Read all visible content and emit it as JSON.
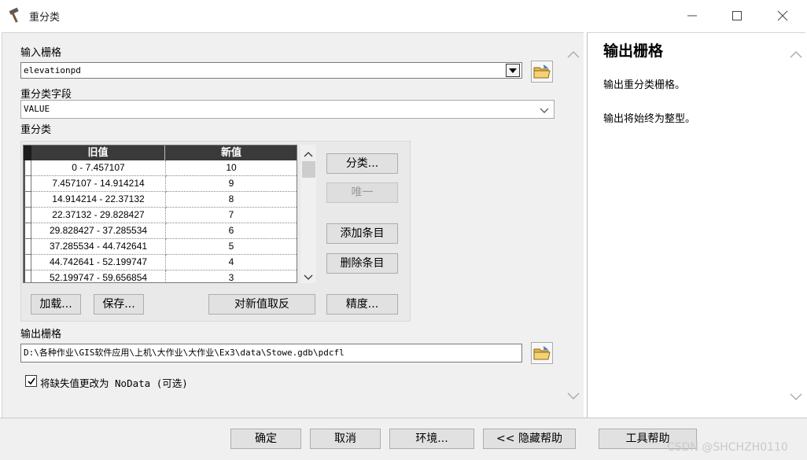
{
  "window": {
    "title": "重分类",
    "icons": {
      "app": "hammer-icon",
      "minimize": "minimize-icon",
      "maximize": "maximize-icon",
      "close": "close-icon"
    }
  },
  "input_raster": {
    "label": "输入栅格",
    "value": "elevationpd"
  },
  "reclass_field": {
    "label": "重分类字段",
    "value": "VALUE"
  },
  "reclassification": {
    "label": "重分类",
    "columns": [
      "旧值",
      "新值"
    ],
    "rows": [
      {
        "old": "0 - 7.457107",
        "new": "10"
      },
      {
        "old": "7.457107 - 14.914214",
        "new": "9"
      },
      {
        "old": "14.914214 - 22.37132",
        "new": "8"
      },
      {
        "old": "22.37132 - 29.828427",
        "new": "7"
      },
      {
        "old": "29.828427 - 37.285534",
        "new": "6"
      },
      {
        "old": "37.285534 - 44.742641",
        "new": "5"
      },
      {
        "old": "44.742641 - 52.199747",
        "new": "4"
      },
      {
        "old": "52.199747 - 59.656854",
        "new": "3"
      }
    ],
    "buttons": {
      "classify": "分类...",
      "unique": "唯一",
      "add_entry": "添加条目",
      "delete_entry": "删除条目",
      "load": "加载...",
      "save": "保存...",
      "reverse": "对新值取反",
      "precision": "精度..."
    }
  },
  "output_raster": {
    "label": "输出栅格",
    "value": "D:\\各种作业\\GIS软件应用\\上机\\大作业\\大作业\\Ex3\\data\\Stowe.gdb\\pdcfl"
  },
  "nodata_option": {
    "label": "将缺失值更改为 NoData (可选)",
    "checked": true
  },
  "help_panel": {
    "title": "输出栅格",
    "line1": "输出重分类栅格。",
    "line2": "输出将始终为整型。"
  },
  "footer": {
    "ok": "确定",
    "cancel": "取消",
    "environments": "环境...",
    "hide_help": "<< 隐藏帮助",
    "tool_help": "工具帮助"
  },
  "watermark": "CSDN @SHCHZH0110"
}
